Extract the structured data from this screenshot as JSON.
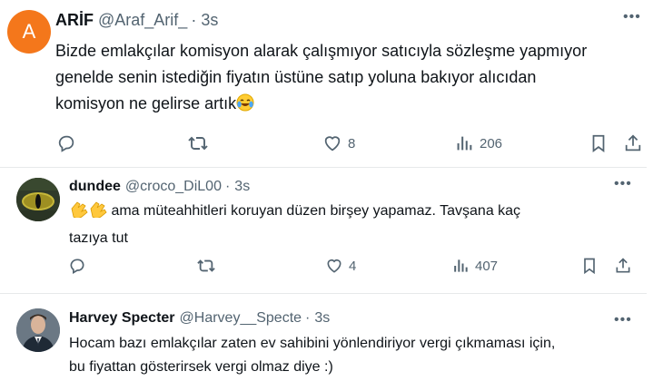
{
  "tweets": [
    {
      "avatar_letter": "A",
      "name": "ARİF",
      "handle": "@Araf_Arif_",
      "separator": "·",
      "time": "3s",
      "lines": [
        "Bizde emlakçılar komisyon alarak çalışmıyor satıcıyla sözleşme yapmıyor",
        "genelde senin istediğin fiyatın üstüne satıp yoluna bakıyor alıcıdan",
        "komisyon ne gelirse artık"
      ],
      "emoji": "crying-laughing-emoji",
      "likes": "8",
      "views": "206"
    },
    {
      "name": "dundee",
      "handle": "@croco_DiL00",
      "separator": "·",
      "time": "3s",
      "emoji": "clapping-hands-emoji",
      "lines": [
        " ama müteahhitleri koruyan düzen birşey yapamaz. Tavşana kaç",
        "tazıya tut"
      ],
      "likes": "4",
      "views": "407"
    },
    {
      "name": "Harvey Specter",
      "handle": "@Harvey__Specte",
      "separator": "·",
      "time": "3s",
      "lines": [
        "Hocam bazı emlakçılar zaten ev sahibini yönlendiriyor vergi çıkmaması için,",
        "bu fiyattan gösterirsek vergi olmaz diye :)"
      ]
    }
  ],
  "colors": {
    "text": "#0f1419",
    "muted": "#536471",
    "divider": "#e7e9ea",
    "avatar_orange": "#f4771b"
  }
}
